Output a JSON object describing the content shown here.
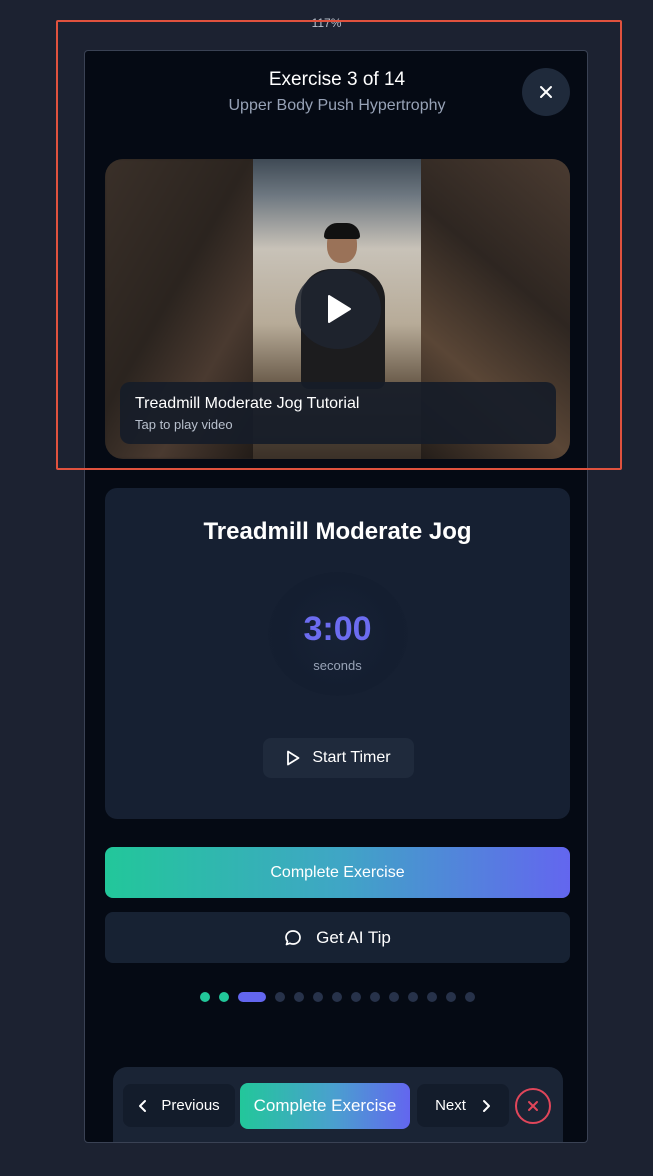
{
  "zoom": {
    "label": "117%"
  },
  "header": {
    "title": "Exercise 3 of 14",
    "subtitle": "Upper Body Push Hypertrophy",
    "close_icon": "close-icon"
  },
  "video": {
    "title": "Treadmill Moderate Jog Tutorial",
    "hint": "Tap to play video",
    "play_icon": "play-icon"
  },
  "exercise": {
    "name": "Treadmill Moderate Jog",
    "timer_value": "3:00",
    "timer_unit": "seconds",
    "start_timer_label": "Start Timer",
    "start_icon": "play-outline-icon"
  },
  "actions": {
    "complete_label": "Complete Exercise",
    "ai_tip_label": "Get AI Tip",
    "ai_tip_icon": "chat-bubble-icon"
  },
  "progress": {
    "total": 14,
    "current": 3,
    "completed": 2
  },
  "bottom_nav": {
    "previous_label": "Previous",
    "complete_label": "Complete Exercise",
    "next_label": "Next",
    "exit_icon": "exit-x-icon"
  },
  "colors": {
    "accent_green": "#22c79a",
    "accent_indigo": "#6366ef",
    "danger": "#e0465a",
    "selection": "#e0523e"
  }
}
